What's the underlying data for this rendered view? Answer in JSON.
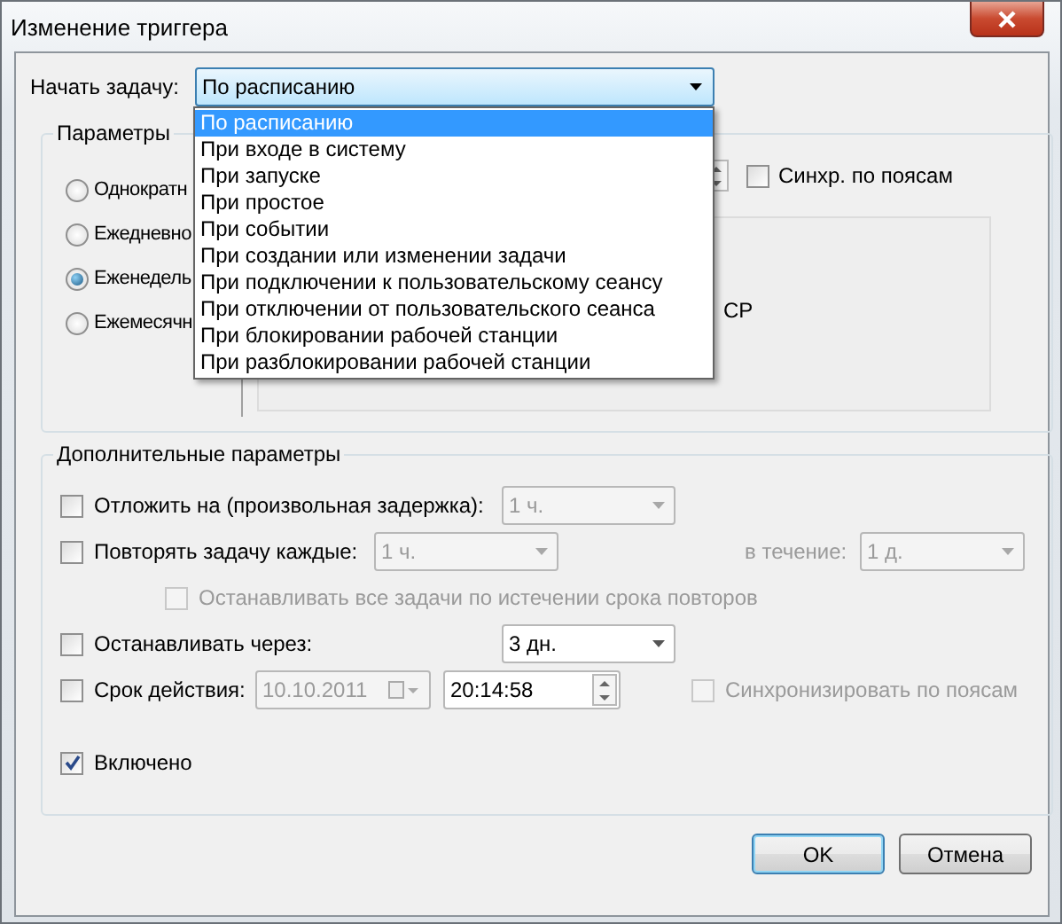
{
  "window": {
    "title": "Изменение триггера"
  },
  "start_task": {
    "label": "Начать задачу:",
    "value": "По расписанию",
    "expanded": true,
    "options": [
      {
        "label": "По расписанию",
        "selected": true
      },
      {
        "label": "При входе в систему",
        "selected": false
      },
      {
        "label": "При запуске",
        "selected": false
      },
      {
        "label": "При простое",
        "selected": false
      },
      {
        "label": "При событии",
        "selected": false
      },
      {
        "label": "При создании или изменении задачи",
        "selected": false
      },
      {
        "label": "При подключении к пользовательскому сеансу",
        "selected": false
      },
      {
        "label": "При отключении от пользовательского сеанса",
        "selected": false
      },
      {
        "label": "При блокировании рабочей станции",
        "selected": false
      },
      {
        "label": "При разблокировании рабочей станции",
        "selected": false
      }
    ]
  },
  "parameters": {
    "title": "Параметры",
    "schedule": [
      {
        "label": "Однократн",
        "selected": false
      },
      {
        "label": "Ежедневно",
        "selected": false
      },
      {
        "label": "Еженедель",
        "selected": true
      },
      {
        "label": "Ежемесячн",
        "selected": false
      }
    ],
    "sync": {
      "label": "Синхр. по поясам",
      "checked": false
    },
    "panel_text": "СР"
  },
  "advanced": {
    "title": "Дополнительные параметры",
    "delay": {
      "label": "Отложить на (произвольная задержка):",
      "checked": false,
      "value": "1 ч.",
      "disabled": true
    },
    "repeat": {
      "label": "Повторять задачу каждые:",
      "checked": false,
      "value": "1 ч.",
      "disabled": true,
      "duration_label": "в течение:",
      "duration_value": "1 д.",
      "stop_all": {
        "label": "Останавливать все задачи по истечении срока повторов",
        "checked": false,
        "disabled": true
      }
    },
    "stop_after": {
      "label": "Останавливать через:",
      "checked": false,
      "value": "3 дн.",
      "disabled": false
    },
    "expires": {
      "label": "Срок действия:",
      "checked": false,
      "date": "10.10.2011",
      "date_disabled": true,
      "time": "20:14:58",
      "sync": {
        "label": "Синхронизировать по поясам",
        "checked": false,
        "disabled": true
      }
    },
    "enabled": {
      "label": "Включено",
      "checked": true
    }
  },
  "buttons": [
    {
      "label": "OK",
      "default": true
    },
    {
      "label": "Отмена",
      "default": false
    }
  ]
}
